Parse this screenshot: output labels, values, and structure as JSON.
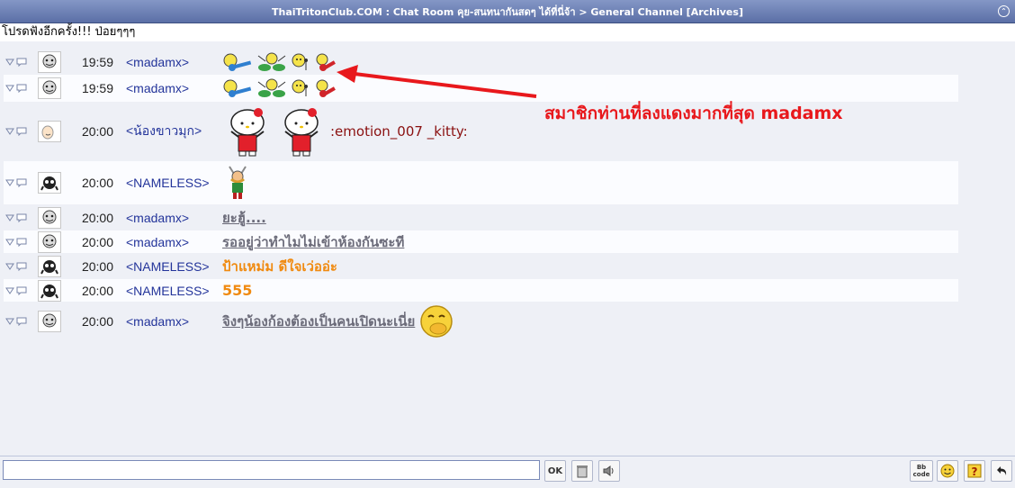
{
  "window": {
    "title": "ThaiTritonClub.COM : Chat Room คุย-สนทนากันสดๆ ได้ที่นี่จ้า > General Channel  [Archives]"
  },
  "topic": "โปรดฟังอีกครั้ง!!! ป่อยๆๆๆ",
  "messages": [
    {
      "time": "19:59",
      "nick": "<madamx>",
      "content": "emoticons"
    },
    {
      "time": "19:59",
      "nick": "<madamx>",
      "content": "emoticons"
    },
    {
      "time": "20:00",
      "nick": "<น้องขาวมุก>",
      "text": ":emotion_007 _kitty:"
    },
    {
      "time": "20:00",
      "nick": "<NAMELESS>",
      "content": "emoticon"
    },
    {
      "time": "20:00",
      "nick": "<madamx>",
      "text": "ยะฮู้...."
    },
    {
      "time": "20:00",
      "nick": "<madamx>",
      "text": "รออยู่ว่าทำไมไม่เข้าห้องกันซะที"
    },
    {
      "time": "20:00",
      "nick": "<NAMELESS>",
      "text": "ป้าแหม่ม ดีใจเว่ออ่ะ"
    },
    {
      "time": "20:00",
      "nick": "<NAMELESS>",
      "text": "555"
    },
    {
      "time": "20:00",
      "nick": "<madamx>",
      "text": "จิงๆน้องก้องต้องเป็นคนเปิดนะเนี่ย"
    }
  ],
  "annotation": "สมาชิกท่านที่ลงแดงมากที่สุด madamx",
  "toolbar": {
    "ok_label": "OK",
    "bbcode_label": "Bb code"
  },
  "colors": {
    "titlebar": "#5b6fa6",
    "nick": "#23349a",
    "annotation": "#e8181c",
    "orange_text": "#f08a10"
  }
}
